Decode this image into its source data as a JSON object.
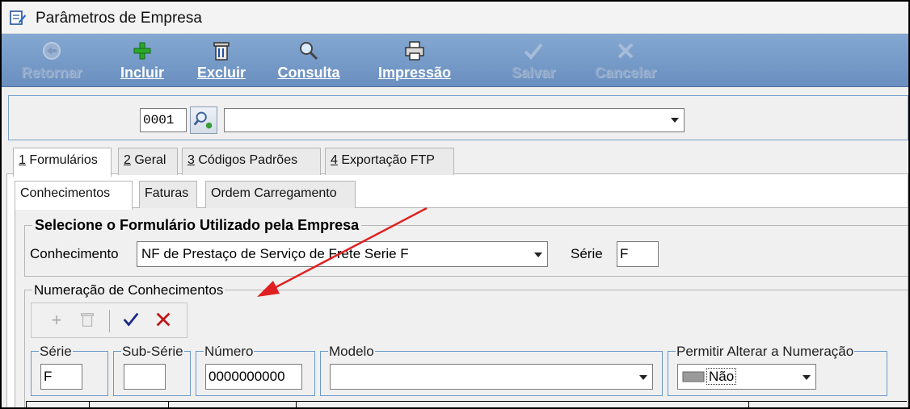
{
  "window": {
    "title": "Parâmetros de Empresa"
  },
  "toolbar": {
    "retomar": "Retornar",
    "incluir": "Incluir",
    "excluir": "Excluir",
    "consulta": "Consulta",
    "impressao": "Impressão",
    "salvar": "Salvar",
    "cancelar": "Cancelar"
  },
  "search": {
    "code": "0001",
    "company_value": ""
  },
  "outer_tabs": [
    {
      "key": "1",
      "label": " Formulários"
    },
    {
      "key": "2",
      "label": " Geral"
    },
    {
      "key": "3",
      "label": " Códigos Padrões"
    },
    {
      "key": "4",
      "label": " Exportação FTP"
    }
  ],
  "inner_tabs": [
    "Conhecimentos",
    "Faturas",
    "Ordem Carregamento"
  ],
  "form_group": {
    "title": "Selecione o Formulário Utilizado pela Empresa",
    "conhecimento_label": "Conhecimento",
    "conhecimento_value": "NF de Prestaço de Serviço de Frete Serie F",
    "serie_label": "Série",
    "serie_value": "F"
  },
  "numbering_group": {
    "title": "Numeração de Conhecimentos",
    "fields": {
      "serie_label": "Série",
      "serie_value": "F",
      "subserie_label": "Sub-Série",
      "subserie_value": "",
      "numero_label": "Número",
      "numero_value": "0000000000",
      "modelo_label": "Modelo",
      "modelo_value": "",
      "permitir_label": "Permitir Alterar a Numeração",
      "permitir_value": "Não"
    }
  },
  "colors": {
    "toolbar": "#7499c8",
    "annotation_arrow": "#e02020",
    "group_border": "#6c98c9"
  }
}
